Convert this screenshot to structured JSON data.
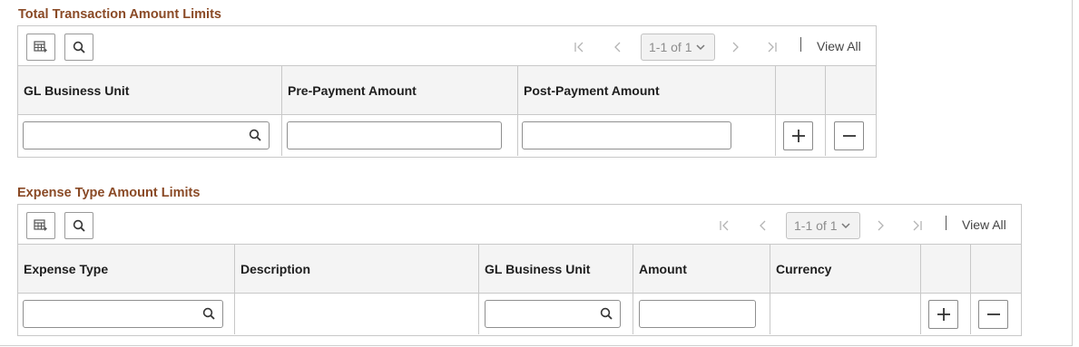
{
  "total_limits": {
    "title": "Total Transaction Amount Limits",
    "pagination": {
      "range": "1-1 of 1",
      "view_all": "View All"
    },
    "columns": [
      "GL Business Unit",
      "Pre-Payment Amount",
      "Post-Payment Amount"
    ],
    "row": {
      "gl_business_unit": "",
      "pre_payment_amount": "",
      "post_payment_amount": ""
    },
    "add_icon": "plus-icon",
    "delete_icon": "minus-icon"
  },
  "expense_limits": {
    "title": "Expense Type Amount Limits",
    "pagination": {
      "range": "1-1 of 1",
      "view_all": "View All"
    },
    "columns": [
      "Expense Type",
      "Description",
      "GL Business Unit",
      "Amount",
      "Currency"
    ],
    "row": {
      "expense_type": "",
      "description": "",
      "gl_business_unit": "",
      "amount": "",
      "currency": ""
    },
    "add_icon": "plus-icon",
    "delete_icon": "minus-icon"
  },
  "icons": [
    "grid-settings-icon",
    "search-icon",
    "first-page-icon",
    "previous-page-icon",
    "next-page-icon",
    "last-page-icon",
    "chevron-down-icon"
  ]
}
